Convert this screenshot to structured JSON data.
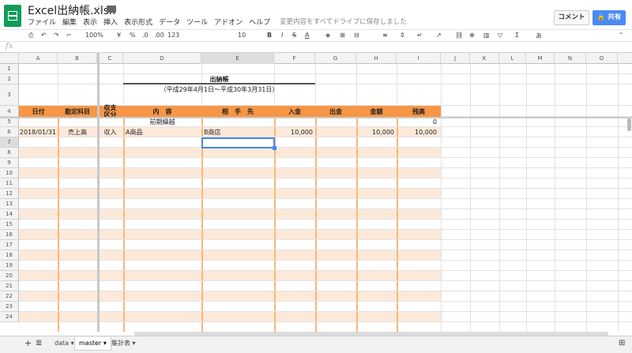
{
  "app": {
    "title": "Excel出納帳.xlsx",
    "menu": [
      "ファイル",
      "編集",
      "表示",
      "挿入",
      "表示形式",
      "データ",
      "ツール",
      "アドオン",
      "ヘルプ"
    ],
    "save_status": "変更内容をすべてドライブに保存しました",
    "comment_label": "コメント",
    "share_label": "共有"
  },
  "toolbar": {
    "zoom": "100%",
    "currency": "¥",
    "percent": "%",
    "dec_dec": ".0",
    "dec_inc": ".00",
    "num_format": "123",
    "font_size": "10",
    "bold": "B",
    "italic": "I",
    "strike": "S",
    "text_color": "A",
    "input_tool": "あ"
  },
  "fx": "fx",
  "columns": [
    "A",
    "B",
    "C",
    "D",
    "E",
    "F",
    "G",
    "H",
    "I",
    "J",
    "K",
    "L",
    "M",
    "N",
    "O"
  ],
  "rows": [
    "1",
    "2",
    "3",
    "4",
    "5",
    "6",
    "7",
    "8",
    "9",
    "10",
    "11",
    "12",
    "13",
    "14",
    "15",
    "16",
    "17",
    "18",
    "19",
    "20",
    "21",
    "22",
    "23",
    "24"
  ],
  "sheet": {
    "title": "出納帳",
    "period": "（平成29年4月1日〜平成30年3月31日）",
    "headers": [
      "日付",
      "勘定科目",
      "収支区分",
      "内　容",
      "相　手　先",
      "入金",
      "出金",
      "金額",
      "残高"
    ],
    "carry_label": "前期繰越",
    "carry_balance": "0",
    "row6": {
      "date": "2018/01/31",
      "account": "売上高",
      "type": "収入",
      "content": "A商品",
      "partner": "B商店",
      "in": "10,000",
      "amount": "10,000",
      "balance": "10,000"
    }
  },
  "sheet_tabs": [
    "data",
    "master",
    "集計表"
  ],
  "colors": {
    "header": "#f79646",
    "band": "#fde9d9",
    "share": "#4a8af4",
    "brand": "#0f9d58"
  }
}
